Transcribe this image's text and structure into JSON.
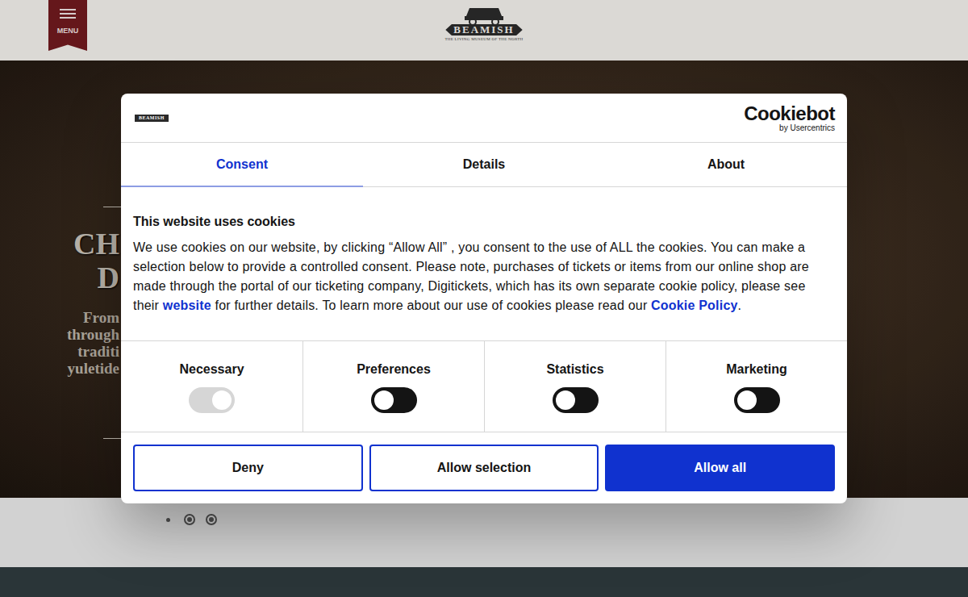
{
  "header": {
    "menu": {
      "label": "MENU"
    },
    "logo": {
      "name": "BEAMISH",
      "tagline": "THE LIVING MUSEUM OF THE NORTH"
    }
  },
  "hero": {
    "title_lines": [
      "CH",
      "D"
    ],
    "text_lines": [
      "From",
      "through",
      "traditi",
      "yuletide"
    ]
  },
  "carousel": {
    "dots": [
      {
        "selected": true
      },
      {
        "selected": false
      },
      {
        "selected": false
      }
    ]
  },
  "dialog": {
    "logo": {
      "name": "BEAMISH"
    },
    "provider": {
      "name": "Cookiebot",
      "by": "by Usercentrics"
    },
    "tabs": [
      {
        "label": "Consent",
        "selected": true
      },
      {
        "label": "Details",
        "selected": false
      },
      {
        "label": "About",
        "selected": false
      }
    ],
    "title": "This website uses cookies",
    "body": [
      {
        "text": "We use cookies on our website, by clicking  “Allow All” , you consent to the use of ALL the cookies. You can make a selection below to provide a controlled consent. Please note, purchases of tickets or items from our online shop are made through the portal of our ticketing company, Digitickets, which has its own separate cookie policy, please see their ",
        "link": false
      },
      {
        "text": "website",
        "link": true
      },
      {
        "text": " for further details. To learn more about our use of cookies please read our ",
        "link": false
      },
      {
        "text": "Cookie Policy",
        "link": true
      },
      {
        "text": ".",
        "link": false
      }
    ],
    "categories": [
      {
        "label": "Necessary",
        "on": true,
        "disabled": true
      },
      {
        "label": "Preferences",
        "on": false,
        "disabled": false
      },
      {
        "label": "Statistics",
        "on": false,
        "disabled": false
      },
      {
        "label": "Marketing",
        "on": false,
        "disabled": false
      }
    ],
    "buttons": [
      {
        "label": "Deny",
        "kind": "outline"
      },
      {
        "label": "Allow selection",
        "kind": "outline"
      },
      {
        "label": "Allow all",
        "kind": "primary"
      }
    ]
  }
}
